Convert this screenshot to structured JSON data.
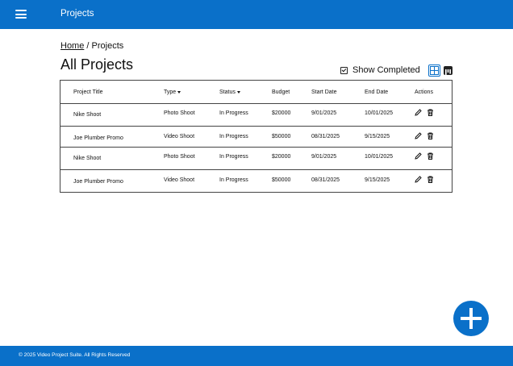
{
  "header": {
    "app_title": "Projects"
  },
  "breadcrumb": {
    "home": "Home",
    "separator": "/",
    "current": "Projects"
  },
  "page": {
    "title": "All Projects"
  },
  "controls": {
    "show_completed_label": "Show Completed",
    "show_completed_checked": true,
    "view_mode": "grid"
  },
  "table": {
    "columns": {
      "title": "Project Title",
      "type": "Type",
      "status": "Status",
      "budget": "Budget",
      "start": "Start Date",
      "end": "End Date",
      "actions": "Actions"
    },
    "rows": [
      {
        "title": "Nike Shoot",
        "type": "Photo Shoot",
        "status": "In Progress",
        "budget": "$20000",
        "start": "9/01/2025",
        "end": "10/01/2025"
      },
      {
        "title": "Joe Plumber Promo",
        "type": "Video Shoot",
        "status": "In Progress",
        "budget": "$50000",
        "start": "08/31/2025",
        "end": "9/15/2025"
      },
      {
        "title": "Nike Shoot",
        "type": "Photo Shoot",
        "status": "In Progress",
        "budget": "$20000",
        "start": "9/01/2025",
        "end": "10/01/2025"
      },
      {
        "title": "Joe Plumber Promo",
        "type": "Video Shoot",
        "status": "In Progress",
        "budget": "$50000",
        "start": "08/31/2025",
        "end": "9/15/2025"
      }
    ]
  },
  "icons": {
    "menu": "hamburger-icon",
    "edit": "pencil-icon",
    "delete": "trash-icon",
    "add": "plus-icon",
    "grid_view": "grid-view-icon",
    "board_view": "kanban-view-icon"
  },
  "colors": {
    "primary": "#0a70c9",
    "text": "#111111",
    "border": "#444444"
  },
  "footer": {
    "text": "© 2025 Video Project Suite.  All Rights Reserved"
  }
}
